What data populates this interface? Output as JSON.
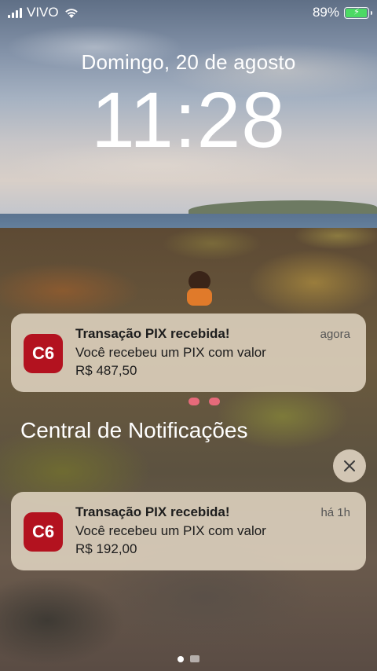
{
  "status_bar": {
    "carrier": "VIVO",
    "battery_percent": "89%",
    "battery_level": 0.89,
    "charging": true,
    "icons": [
      "signal-icon",
      "wifi-icon",
      "battery-icon",
      "charging-bolt-icon"
    ]
  },
  "lock_screen": {
    "date": "Domingo, 20 de agosto",
    "time": "11:28"
  },
  "notifications": [
    {
      "app_icon_text": "C6",
      "title": "Transação PIX recebida!",
      "body_line1": "Você recebeu um PIX com valor",
      "body_line2": "R$ 487,50",
      "time": "agora"
    }
  ],
  "notification_center": {
    "title": "Central de Notificações",
    "clear_icon": "close-icon",
    "items": [
      {
        "app_icon_text": "C6",
        "title": "Transação PIX recebida!",
        "body_line1": "Você recebeu um PIX com valor",
        "body_line2": "R$ 192,00",
        "time": "há 1h"
      }
    ]
  },
  "colors": {
    "app_icon_bg": "#b3121f",
    "battery_fill": "#4cd964",
    "notification_bg": "#e2d6c4"
  }
}
